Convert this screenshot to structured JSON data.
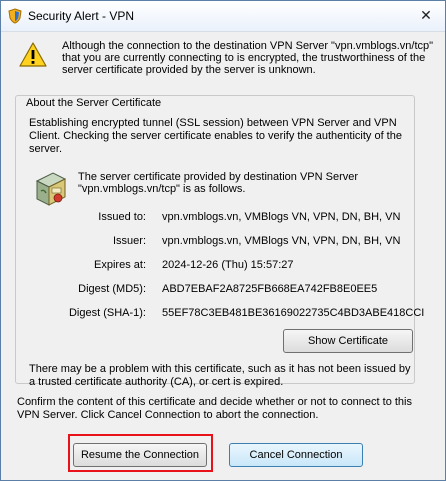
{
  "window": {
    "title": "Security Alert - VPN",
    "close_glyph": "✕"
  },
  "icons": {
    "title": "shield-icon",
    "warning": "warning-triangle-icon",
    "certificate": "certificate-icon"
  },
  "intro_text": "Although the connection to the destination VPN Server \"vpn.vmblogs.vn/tcp\" that you are currently connecting to is encrypted, the trustworthiness of the server certificate provided by the server is unknown.",
  "about": {
    "legend": "About the Server Certificate",
    "description": "Establishing encrypted tunnel (SSL session) between VPN Server and VPN Client. Checking the server certificate enables to verify the authenticity of the server.",
    "cert_intro": "The server certificate provided by destination VPN Server \"vpn.vmblogs.vn/tcp\" is as follows.",
    "fields": [
      {
        "label": "Issued to:",
        "value": "vpn.vmblogs.vn, VMBlogs VN, VPN, DN, BH, VN"
      },
      {
        "label": "Issuer:",
        "value": "vpn.vmblogs.vn, VMBlogs VN, VPN, DN, BH, VN"
      },
      {
        "label": "Expires at:",
        "value": "2024-12-26 (Thu) 15:57:27"
      },
      {
        "label": "Digest (MD5):",
        "value": "ABD7EBAF2A8725FB668EA742FB8E0EE5"
      },
      {
        "label": "Digest (SHA-1):",
        "value": "55EF78C3EB481BE36169022735C4BD3ABE418CCI"
      }
    ],
    "show_certificate_label": "Show Certificate",
    "problem_text": "There may be a problem with this certificate, such as it has not been issued by a trusted certificate authority (CA), or cert is expired."
  },
  "confirm_text": "Confirm the content of this certificate and decide whether or not to connect to this VPN Server. Click Cancel Connection to abort the connection.",
  "buttons": {
    "resume": "Resume the Connection",
    "cancel": "Cancel Connection"
  },
  "colors": {
    "highlight": "#e8131a",
    "border": "#5b7fa6",
    "background": "#f0f0f0"
  }
}
